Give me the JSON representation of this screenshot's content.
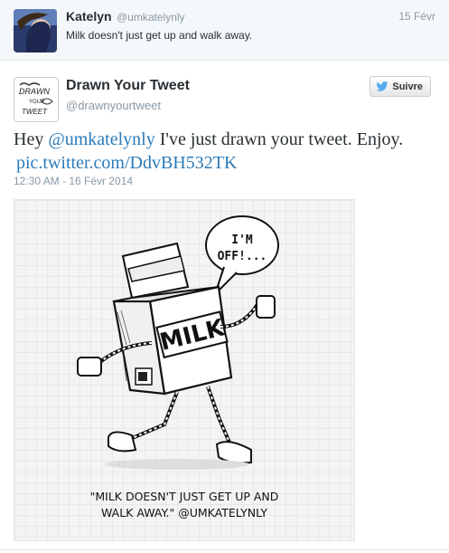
{
  "reply": {
    "name": "Katelyn",
    "handle": "@umkatelynly",
    "date": "15 Févr",
    "text": "Milk doesn't just get up and walk away."
  },
  "tweet": {
    "name": "Drawn Your Tweet",
    "handle": "@drawnyourtweet",
    "follow_label": "Suivre",
    "text_prefix": "Hey ",
    "mention": "@umkatelynly",
    "text_body": " I've just drawn your tweet. Enjoy.",
    "link": "pic.twitter.com/DdvBH532TK",
    "timestamp": "12:30 AM - 16 Févr 2014",
    "avatar_logo_text": "DRAWN YOUR TWEET"
  },
  "drawing": {
    "speech_line1": "I'M",
    "speech_line2": "OFF!...",
    "carton_label": "MILK",
    "caption_line1": "\"MILK DOESN'T JUST GET UP AND",
    "caption_line2": "WALK AWAY.\" @UMKATELYNLY"
  },
  "colors": {
    "link": "#2b7bb9",
    "muted": "#8899a6",
    "twitter_bird": "#55acee"
  }
}
